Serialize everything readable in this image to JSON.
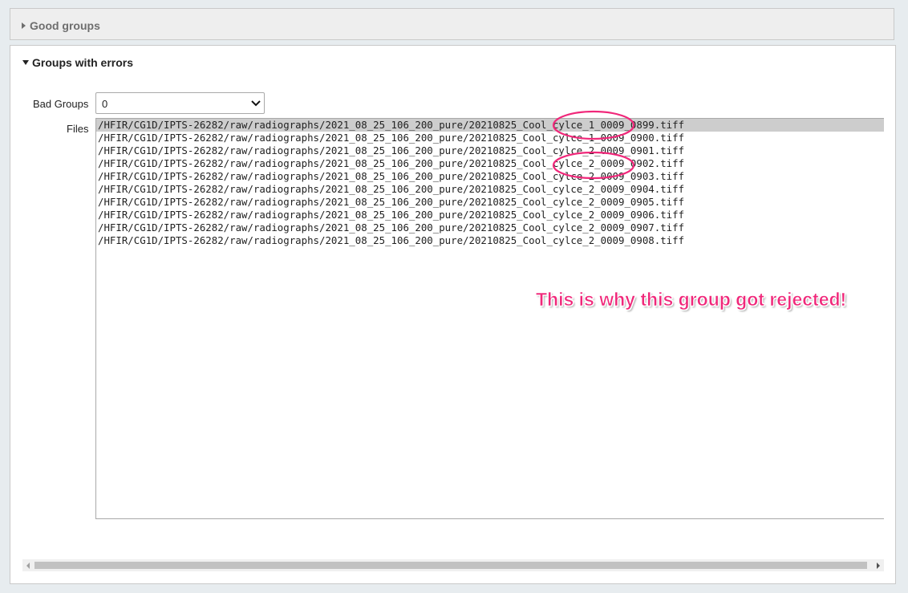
{
  "good_groups": {
    "title": "Good groups"
  },
  "error_groups": {
    "title": "Groups with errors",
    "bad_groups_label": "Bad Groups",
    "bad_groups_value": "0",
    "files_label": "Files",
    "files": [
      "/HFIR/CG1D/IPTS-26282/raw/radiographs/2021_08_25_106_200_pure/20210825_Cool_cylce_1_0009_0899.tiff",
      "/HFIR/CG1D/IPTS-26282/raw/radiographs/2021_08_25_106_200_pure/20210825_Cool_cylce_1_0009_0900.tiff",
      "/HFIR/CG1D/IPTS-26282/raw/radiographs/2021_08_25_106_200_pure/20210825_Cool_cylce_2_0009_0901.tiff",
      "/HFIR/CG1D/IPTS-26282/raw/radiographs/2021_08_25_106_200_pure/20210825_Cool_cylce_2_0009_0902.tiff",
      "/HFIR/CG1D/IPTS-26282/raw/radiographs/2021_08_25_106_200_pure/20210825_Cool_cylce_2_0009_0903.tiff",
      "/HFIR/CG1D/IPTS-26282/raw/radiographs/2021_08_25_106_200_pure/20210825_Cool_cylce_2_0009_0904.tiff",
      "/HFIR/CG1D/IPTS-26282/raw/radiographs/2021_08_25_106_200_pure/20210825_Cool_cylce_2_0009_0905.tiff",
      "/HFIR/CG1D/IPTS-26282/raw/radiographs/2021_08_25_106_200_pure/20210825_Cool_cylce_2_0009_0906.tiff",
      "/HFIR/CG1D/IPTS-26282/raw/radiographs/2021_08_25_106_200_pure/20210825_Cool_cylce_2_0009_0907.tiff",
      "/HFIR/CG1D/IPTS-26282/raw/radiographs/2021_08_25_106_200_pure/20210825_Cool_cylce_2_0009_0908.tiff"
    ],
    "selected_file_index": 0
  },
  "annotation": {
    "text": "This is why this group got rejected!",
    "color": "#f0287a"
  },
  "icons": {
    "collapsed": "caret-right-icon",
    "expanded": "caret-down-icon",
    "dropdown": "chevron-down-icon"
  }
}
